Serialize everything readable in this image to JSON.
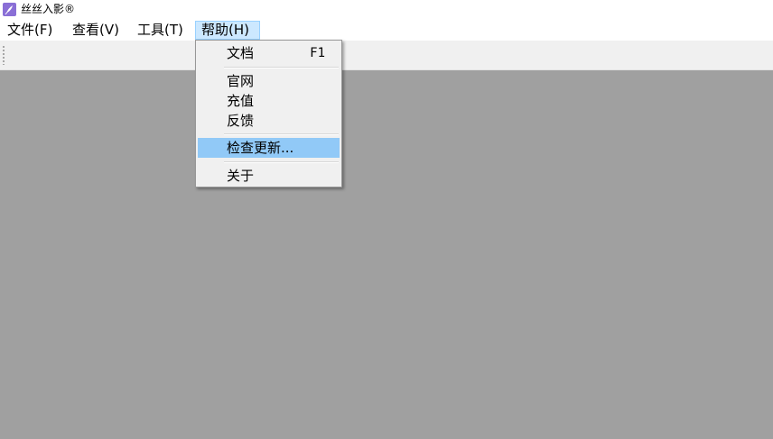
{
  "window": {
    "title": "丝丝入影®",
    "icon": "app-feather-icon"
  },
  "menubar": {
    "items": [
      {
        "label": "文件(F)"
      },
      {
        "label": "查看(V)"
      },
      {
        "label": "工具(T)"
      },
      {
        "label": "帮助(H)"
      }
    ],
    "active": "帮助(H)"
  },
  "help_menu": {
    "items": [
      {
        "label": "文档",
        "shortcut": "F1"
      },
      {
        "label": "官网"
      },
      {
        "label": "充值"
      },
      {
        "label": "反馈"
      },
      {
        "label": "检查更新..."
      },
      {
        "label": "关于"
      }
    ],
    "highlighted": "检查更新..."
  },
  "colors": {
    "workspace": "#a0a0a0",
    "highlight": "#91c9f7",
    "active_menu": "#cce8ff",
    "toolbar": "#f0f0f0"
  }
}
